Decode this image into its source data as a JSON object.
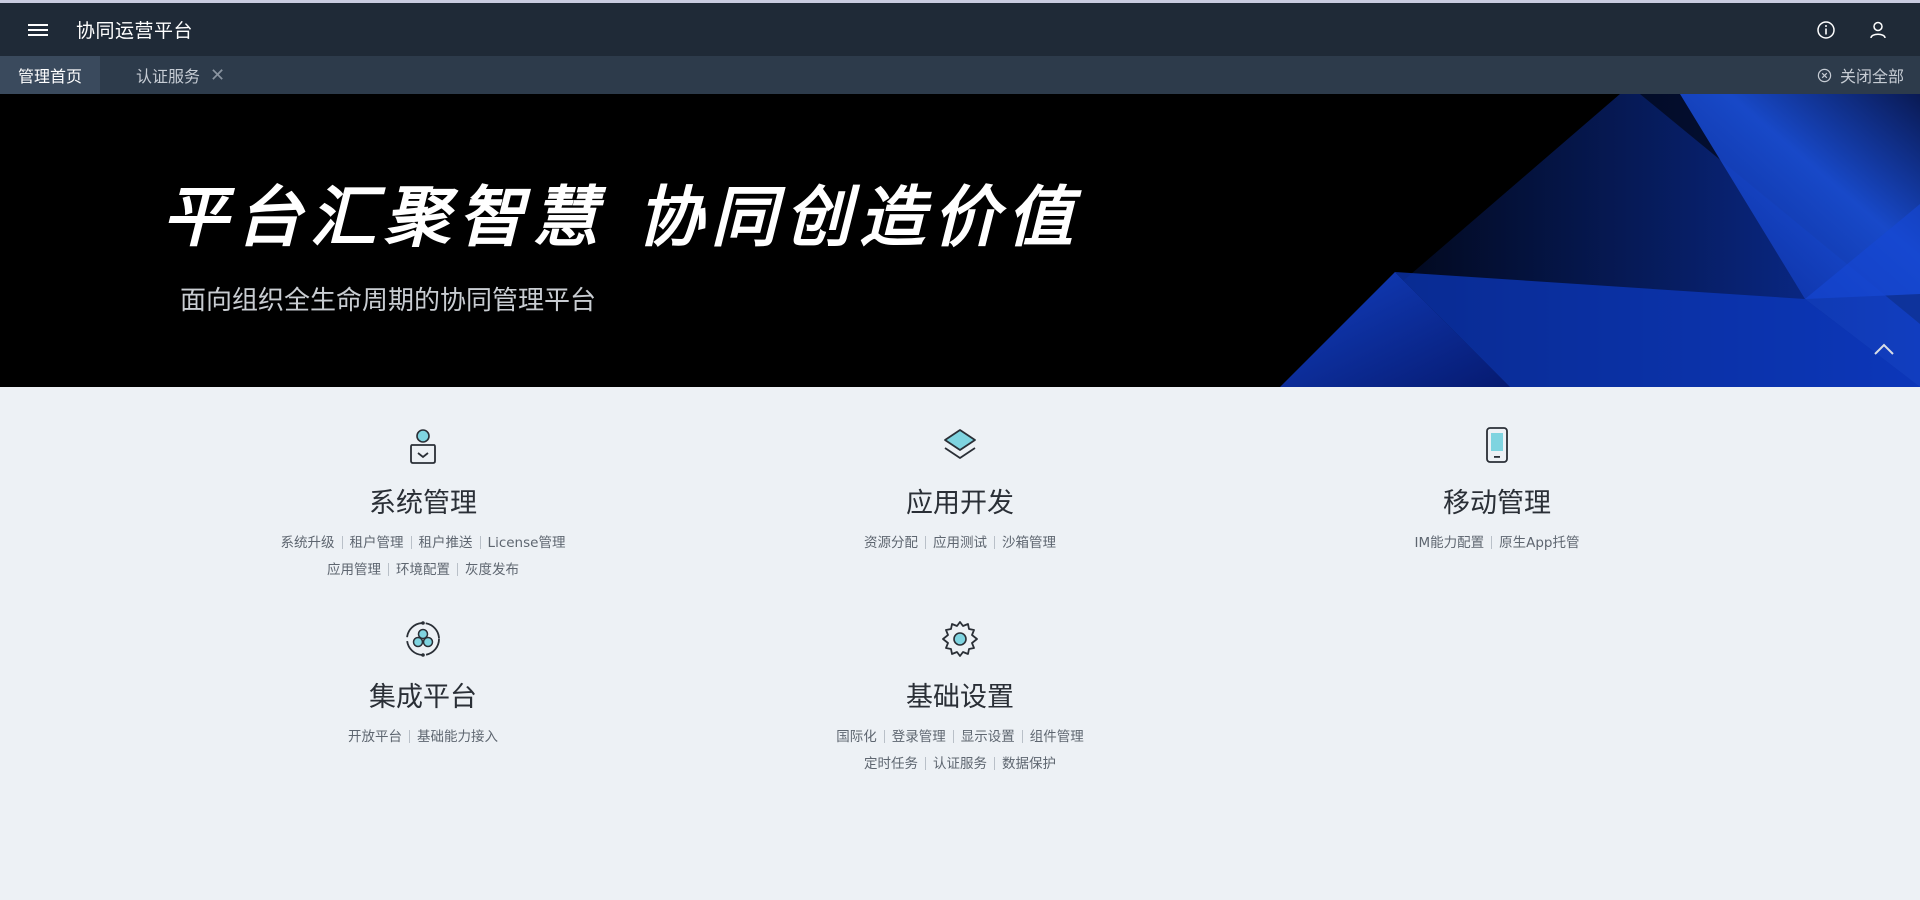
{
  "header": {
    "title": "协同运营平台",
    "icons": {
      "menu": "menu-icon",
      "info": "info-icon",
      "user": "user-icon"
    }
  },
  "tabs": [
    {
      "label": "管理首页",
      "active": true
    },
    {
      "label": "认证服务",
      "active": false,
      "closable": true
    }
  ],
  "tab_close_glyph": "✕",
  "close_all_label": "关闭全部",
  "banner": {
    "slogan": "平台汇聚智慧 协同创造价值",
    "subtitle": "面向组织全生命周期的协同管理平台"
  },
  "modules": [
    {
      "icon": "user-badge-icon",
      "title": "系统管理",
      "link_rows": [
        [
          "系统升级",
          "租户管理",
          "租户推送",
          "License管理"
        ],
        [
          "应用管理",
          "环境配置",
          "灰度发布"
        ]
      ]
    },
    {
      "icon": "layers-icon",
      "title": "应用开发",
      "link_rows": [
        [
          "资源分配",
          "应用测试",
          "沙箱管理"
        ]
      ]
    },
    {
      "icon": "mobile-icon",
      "title": "移动管理",
      "link_rows": [
        [
          "IM能力配置",
          "原生App托管"
        ]
      ]
    },
    {
      "icon": "integration-icon",
      "title": "集成平台",
      "link_rows": [
        [
          "开放平台",
          "基础能力接入"
        ]
      ]
    },
    {
      "icon": "gear-icon",
      "title": "基础设置",
      "link_rows": [
        [
          "国际化",
          "登录管理",
          "显示设置",
          "组件管理"
        ],
        [
          "定时任务",
          "认证服务",
          "数据保护"
        ]
      ]
    }
  ],
  "colors": {
    "header_bg": "#1f2a37",
    "tabbar_bg": "#2d3b4b",
    "banner_accent": "#1a4fd8",
    "icon_accent": "#7fd4e0",
    "page_bg": "#edf1f5"
  }
}
